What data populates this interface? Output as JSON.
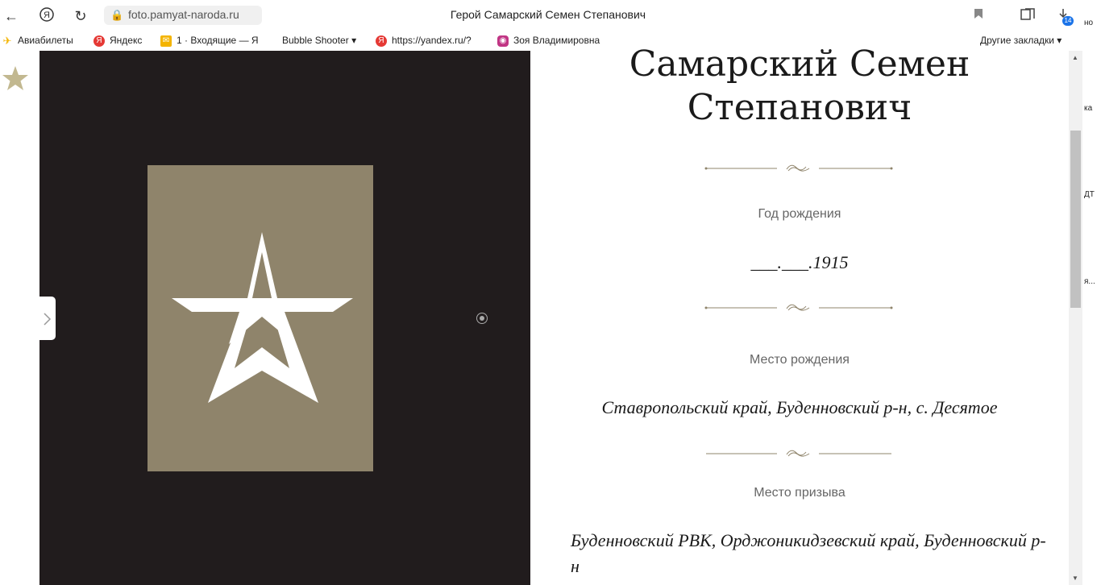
{
  "browser": {
    "url": "foto.pamyat-naroda.ru",
    "page_title": "Герой Самарский Семен Степанович",
    "downloads_badge": "14",
    "bookmarks": [
      {
        "label": "Авиабилеты",
        "icon": "plane-icon",
        "color": "#f4b400"
      },
      {
        "label": "Яндекс",
        "icon": "yandex-icon",
        "color": "#e53935"
      },
      {
        "label": "1 · Входящие — Я",
        "icon": "mail-icon",
        "color": "#f4b400"
      },
      {
        "label": "Bubble Shooter ▾",
        "icon": "",
        "color": ""
      },
      {
        "label": "https://yandex.ru/?",
        "icon": "yandex-icon",
        "color": "#e53935"
      },
      {
        "label": "Зоя Владимировна",
        "icon": "instagram-icon",
        "color": "#c13584"
      }
    ],
    "other_bookmarks": "Другие закладки ▾"
  },
  "hero": {
    "name": "Самарский Семен Степанович",
    "fields": [
      {
        "label": "Год рождения",
        "value": "___.___.1915"
      },
      {
        "label": "Место рождения",
        "value": "Ставропольский край, Буденновский р-н, с. Десятое"
      },
      {
        "label": "Место призыва",
        "value": "Буденновский РВК, Орджоникидзевский край, Буденновский р-н"
      }
    ]
  },
  "edge_text": [
    "но",
    "ка",
    "ДТ",
    "я..."
  ],
  "colors": {
    "accent": "#8f846b",
    "dark_bg": "#211c1d",
    "star_muted": "#c2b890"
  }
}
